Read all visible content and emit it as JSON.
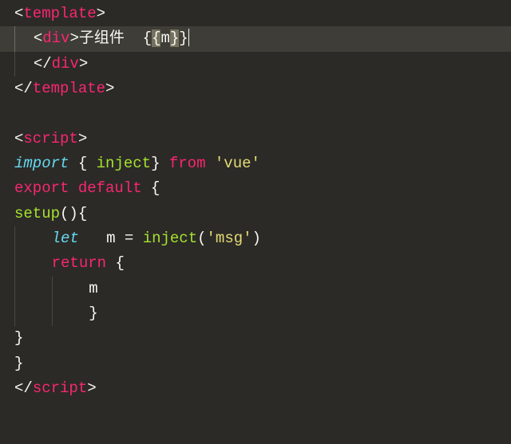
{
  "code": {
    "tag_template": "template",
    "tag_div": "div",
    "text_child": "子组件",
    "expr_open": "{",
    "expr_close": "}",
    "var_m": "m",
    "tag_script": "script",
    "kw_import": "import",
    "fn_inject": "inject",
    "kw_from": "from",
    "str_vue": "'vue'",
    "kw_export": "export",
    "kw_default": "default",
    "fn_setup": "setup",
    "kw_let": "let",
    "str_msg": "'msg'",
    "kw_return": "return"
  }
}
